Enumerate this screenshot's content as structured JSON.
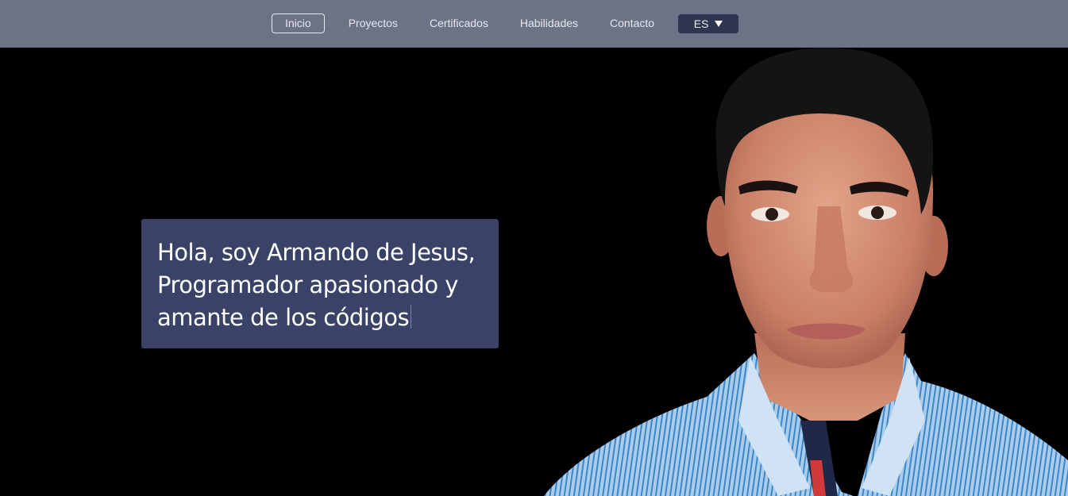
{
  "nav": {
    "items": [
      {
        "label": "Inicio",
        "active": true
      },
      {
        "label": "Proyectos",
        "active": false
      },
      {
        "label": "Certificados",
        "active": false
      },
      {
        "label": "Habilidades",
        "active": false
      },
      {
        "label": "Contacto",
        "active": false
      }
    ],
    "language": {
      "selected": "ES",
      "icon": "caret-down-icon"
    }
  },
  "hero": {
    "greeting_line1": "Hola, soy Armando de Jesus,",
    "greeting_line2": "Programador apasionado y",
    "greeting_line3": "amante de los códigos"
  },
  "colors": {
    "nav_background": "#6d7386",
    "page_background": "#000000",
    "intro_box": "#3a4268",
    "language_button": "#2e3550",
    "text": "#ffffff"
  }
}
